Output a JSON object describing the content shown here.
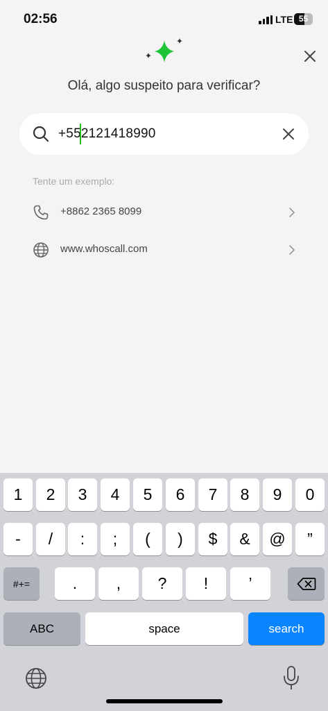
{
  "status_bar": {
    "time": "02:56",
    "network": "LTE",
    "battery_text": "55",
    "battery_level": 0.55
  },
  "header": {
    "greeting": "Olá, algo suspeito para verificar?",
    "logo_icon": "sparkle-icon",
    "accent_color": "#1ec337"
  },
  "search": {
    "value": "+552121418990",
    "clear_icon": "close-icon"
  },
  "examples": {
    "label": "Tente um exemplo:",
    "items": [
      {
        "icon": "phone-icon",
        "text": "+8862 2365 8099"
      },
      {
        "icon": "globe-icon",
        "text": "www.whoscall.com"
      }
    ]
  },
  "keyboard": {
    "row1": [
      "1",
      "2",
      "3",
      "4",
      "5",
      "6",
      "7",
      "8",
      "9",
      "0"
    ],
    "row2": [
      "-",
      "/",
      ":",
      ";",
      "(",
      ")",
      "$",
      "&",
      "@",
      "”"
    ],
    "row3_left": "#+=",
    "row3": [
      ".",
      ",",
      "?",
      "!",
      "’"
    ],
    "abc": "ABC",
    "space": "space",
    "search": "search",
    "search_color": "#0a84ff"
  }
}
